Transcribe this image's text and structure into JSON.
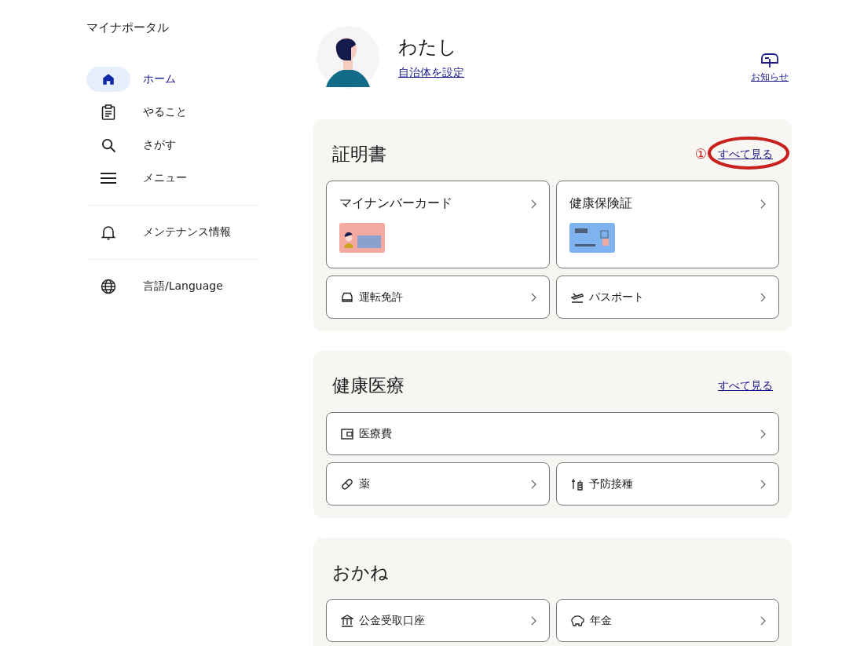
{
  "sidebar": {
    "title": "マイナポータル",
    "items": [
      {
        "label": "ホーム",
        "selected": true,
        "divider_before": false
      },
      {
        "label": "やること",
        "selected": false,
        "divider_before": false
      },
      {
        "label": "さがす",
        "selected": false,
        "divider_before": false
      },
      {
        "label": "メニュー",
        "selected": false,
        "divider_before": false
      },
      {
        "label": "メンテナンス情報",
        "selected": false,
        "divider_before": true
      },
      {
        "label": "言語/Language",
        "selected": false,
        "divider_before": true
      }
    ]
  },
  "header": {
    "name": "わたし",
    "municipality_link": "自治体を設定",
    "notice_label": "お知らせ"
  },
  "sections": [
    {
      "title": "証明書",
      "see_all": "すべて見る",
      "annotation": "①",
      "items": [
        {
          "kind": "card",
          "label": "マイナンバーカード"
        },
        {
          "kind": "card",
          "label": "健康保険証"
        },
        {
          "kind": "half",
          "label": "運転免許"
        },
        {
          "kind": "half",
          "label": "パスポート"
        }
      ]
    },
    {
      "title": "健康医療",
      "see_all": "すべて見る",
      "items": [
        {
          "kind": "wide",
          "label": "医療費"
        },
        {
          "kind": "half",
          "label": "薬"
        },
        {
          "kind": "half",
          "label": "予防接種"
        }
      ]
    },
    {
      "title": "おかね",
      "items": [
        {
          "kind": "half",
          "label": "公金受取口座"
        },
        {
          "kind": "half",
          "label": "年金"
        }
      ]
    }
  ]
}
